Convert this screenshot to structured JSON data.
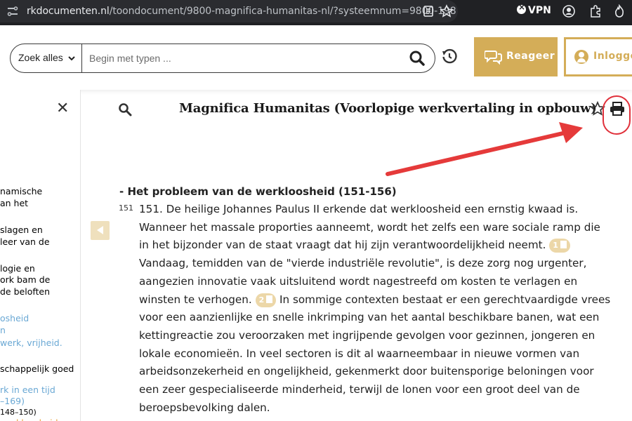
{
  "browser": {
    "url_host": "rkdocumenten.nl",
    "url_path": "/toondocument/9800-magnifica-humanitas-nl/?systeemnum=9800-198",
    "vpn_label": "VPN"
  },
  "header": {
    "scope_label": "Zoek alles",
    "search_placeholder": "Begin met typen ...",
    "reageer_label": "Reageer",
    "inloggen_label": "Inlogge",
    "accent_color": "#d4ad58"
  },
  "sidebar": {
    "items": [
      {
        "text": "namische",
        "cls": "dark"
      },
      {
        "text": "an het",
        "cls": "dark"
      },
      {
        "text": "slagen en",
        "cls": "dark"
      },
      {
        "text": "leer van de",
        "cls": "dark"
      },
      {
        "text": "logie en",
        "cls": "dark"
      },
      {
        "text": "ork bam de",
        "cls": "dark"
      },
      {
        "text": "de beloften",
        "cls": "dark"
      },
      {
        "text": "osheid",
        "cls": "blue"
      },
      {
        "text": "n",
        "cls": "blue"
      },
      {
        "text": "werk, vrijheid.",
        "cls": "blue"
      },
      {
        "text": "schappelijk goed",
        "cls": "dark"
      },
      {
        "text": "rk in een tijd",
        "cls": "blue"
      },
      {
        "text": "–169)",
        "cls": "blue"
      },
      {
        "text": "148–150)",
        "cls": "dark"
      },
      {
        "text": "werkloosheid",
        "cls": "orange"
      }
    ]
  },
  "document": {
    "title": "Magnifica Humanitas (Voorlopige werkvertaling in opbouw)",
    "section_heading": "- Het probleem van de werkloosheid (151-156)",
    "paragraph_number": "151",
    "footnote_1": "1",
    "footnote_2": "2",
    "lines": {
      "l1": "151. De heilige Johannes Paulus II erkende dat werkloosheid een ernstig kwaad is.",
      "l2": "Wanneer het massale proporties aanneemt, wordt het zelfs een ware sociale ramp die",
      "l3": "in het bijzonder van de staat vraagt dat hij zijn verantwoordelijkheid neemt.",
      "l4": "Vandaag, temidden van de \"vierde industriële revolutie\", is deze zorg nog urgenter,",
      "l5": "aangezien innovatie vaak uitsluitend wordt nagestreefd om kosten te verlagen en",
      "l6a": "winsten te verhogen.",
      "l6b": "In sommige contexten bestaat er een gerechtvaardigde vrees",
      "l7": "voor een aanzienlijke en snelle inkrimping van het aantal beschikbare banen, wat een",
      "l8": "kettingreactie zou veroorzaken met ingrijpende gevolgen voor gezinnen, jongeren en",
      "l9": "lokale economieën. In veel sectoren is dit al waarneembaar in nieuwe vormen van",
      "l10": "arbeidsonzekerheid en ongelijkheid, gekenmerkt door buitensporige beloningen voor",
      "l11": "een zeer gespecialiseerde minderheid, terwijl de lonen voor een groot deel van de",
      "l12": "beroepsbevolking dalen."
    }
  }
}
